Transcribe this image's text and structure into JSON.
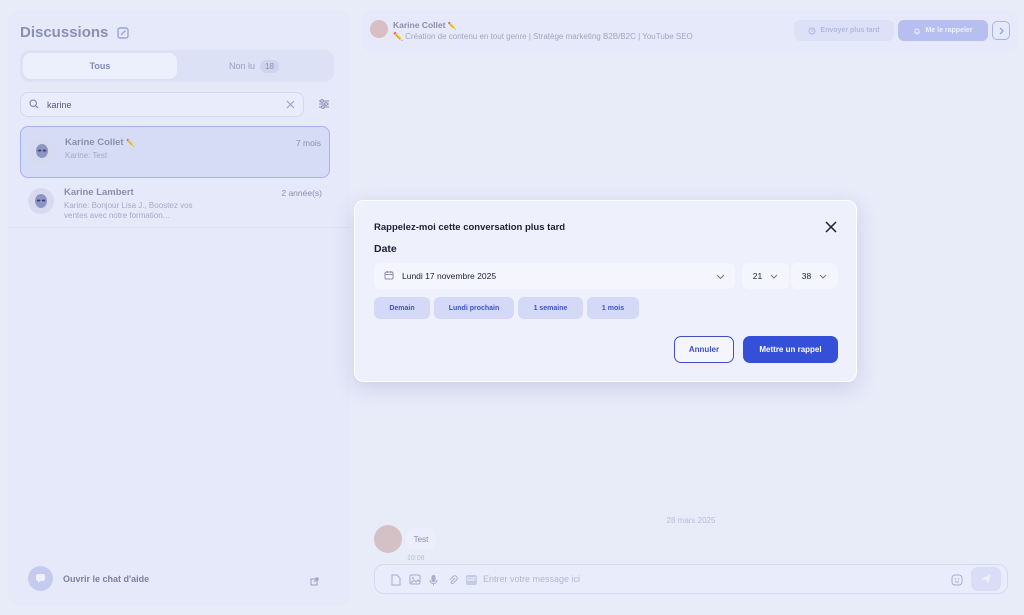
{
  "sidebar": {
    "title": "Discussions",
    "tabs": [
      {
        "label": "Tous"
      },
      {
        "label": "Non lu",
        "badge": "18"
      }
    ],
    "search": {
      "value": "karine"
    },
    "conversations": [
      {
        "name": "Karine Collet",
        "name_emoji": "✏️",
        "time": "7 mois",
        "preview": "Karine: Test",
        "selected": true
      },
      {
        "name": "Karine Lambert",
        "time": "2 année(s)",
        "preview": "Karine: Bonjour Lisa J., Boostez vos ventes avec notre formation..."
      }
    ],
    "help_label": "Ouvrir le chat d'aide"
  },
  "chat_header": {
    "name": "Karine Collet",
    "name_emoji": "✏️",
    "subtitle": "✏️ Création de contenu en tout genre | Stratège marketing B2B/B2C | YouTube SEO",
    "send_later_label": "Envoyer plus tard",
    "remind_label": "Me le rappeler"
  },
  "messages": {
    "date_separator": "28 mars 2025",
    "items": [
      {
        "text": "Test",
        "time": "10:08"
      }
    ]
  },
  "composer": {
    "placeholder": "Entrer votre message ici",
    "gif_label": "GIF"
  },
  "modal": {
    "title": "Rappelez-moi cette conversation plus tard",
    "date_label": "Date",
    "date_value": "Lundi 17 novembre 2025",
    "hour": "21",
    "minute": "38",
    "quick_options": [
      "Demain",
      "Lundi prochain",
      "1 semaine",
      "1 mois"
    ],
    "cancel_label": "Annuler",
    "confirm_label": "Mettre un rappel"
  },
  "colors": {
    "accent": "#3550d8",
    "quick_option_bg": "#d3d9f6",
    "page_bg": "#e8ebf8"
  }
}
